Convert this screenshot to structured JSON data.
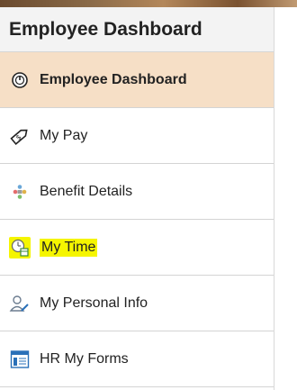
{
  "header": {
    "title": "Employee Dashboard"
  },
  "menu": [
    {
      "label": "Employee Dashboard",
      "icon": "dashboard-icon",
      "active": true
    },
    {
      "label": "My Pay",
      "icon": "pay-tag-icon",
      "active": false
    },
    {
      "label": "Benefit Details",
      "icon": "benefits-icon",
      "active": false
    },
    {
      "label": "My Time",
      "icon": "clock-calendar-icon",
      "active": false,
      "highlighted": true
    },
    {
      "label": "My Personal Info",
      "icon": "person-edit-icon",
      "active": false
    },
    {
      "label": "HR My Forms",
      "icon": "form-window-icon",
      "active": false
    }
  ],
  "colors": {
    "active_bg": "#f6dfc6",
    "highlight": "#f5f500",
    "icon_blue": "#2a70b8"
  }
}
